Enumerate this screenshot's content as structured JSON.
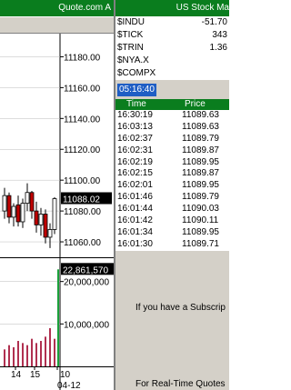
{
  "chart_window": {
    "title": "Quote.com  A"
  },
  "chart_data": {
    "type": "candlestick",
    "price_axis": {
      "ticks": [
        "11180.00",
        "11160.00",
        "11140.00",
        "11120.00",
        "11100.00",
        "11080.00",
        "11060.00"
      ],
      "tick_values": [
        11180,
        11160,
        11140,
        11120,
        11100,
        11080,
        11060
      ],
      "range": [
        11050,
        11195
      ]
    },
    "last_price": {
      "label": "11088.02",
      "value": 11088.02
    },
    "volume_axis": {
      "ticks": [
        "20,000,000",
        "10,000,000"
      ],
      "tick_values": [
        20000000,
        10000000
      ],
      "range": [
        0,
        25500000
      ]
    },
    "last_volume": {
      "label": "22,861,570",
      "value": 22861570
    },
    "x_ticks": [
      "14",
      "15",
      "10"
    ],
    "x_date_label": "04-12",
    "candles": [
      {
        "o": 11080,
        "h": 11095,
        "l": 11075,
        "c": 11090,
        "dir": "up"
      },
      {
        "o": 11090,
        "h": 11092,
        "l": 11072,
        "c": 11076,
        "dir": "down"
      },
      {
        "o": 11076,
        "h": 11085,
        "l": 11070,
        "c": 11083,
        "dir": "up"
      },
      {
        "o": 11084,
        "h": 11090,
        "l": 11070,
        "c": 11073,
        "dir": "down"
      },
      {
        "o": 11073,
        "h": 11088,
        "l": 11069,
        "c": 11085,
        "dir": "up"
      },
      {
        "o": 11085,
        "h": 11098,
        "l": 11080,
        "c": 11092,
        "dir": "up"
      },
      {
        "o": 11092,
        "h": 11093,
        "l": 11075,
        "c": 11080,
        "dir": "down"
      },
      {
        "o": 11080,
        "h": 11086,
        "l": 11066,
        "c": 11071,
        "dir": "down"
      },
      {
        "o": 11071,
        "h": 11082,
        "l": 11064,
        "c": 11078,
        "dir": "up"
      },
      {
        "o": 11078,
        "h": 11081,
        "l": 11059,
        "c": 11063,
        "dir": "down"
      },
      {
        "o": 11063,
        "h": 11072,
        "l": 11056,
        "c": 11068,
        "dir": "up"
      },
      {
        "o": 11068,
        "h": 11089,
        "l": 11065,
        "c": 11088,
        "dir": "up"
      }
    ],
    "volumes": [
      4000000,
      5000000,
      4500000,
      6000000,
      5500000,
      5000000,
      6500000,
      5500000,
      6000000,
      7000000,
      9000000,
      6500000,
      22861570
    ]
  },
  "market_window": {
    "title": "US Stock Ma",
    "indices": [
      {
        "symbol": "$INDU",
        "value": "-51.70"
      },
      {
        "symbol": "$TICK",
        "value": "343"
      },
      {
        "symbol": "$TRIN",
        "value": "1.36"
      },
      {
        "symbol": "$NYA.X",
        "value": ""
      },
      {
        "symbol": "$COMPX",
        "value": ""
      }
    ],
    "clock": "05:16:40",
    "time_sales": {
      "columns": [
        "Time",
        "Price"
      ],
      "rows": [
        {
          "time": "16:30:19",
          "price": "11089.63"
        },
        {
          "time": "16:03:13",
          "price": "11089.63"
        },
        {
          "time": "16:02:37",
          "price": "11089.79"
        },
        {
          "time": "16:02:31",
          "price": "11089.87"
        },
        {
          "time": "16:02:19",
          "price": "11089.95"
        },
        {
          "time": "16:02:15",
          "price": "11089.87"
        },
        {
          "time": "16:02:01",
          "price": "11089.95"
        },
        {
          "time": "16:01:46",
          "price": "11089.79"
        },
        {
          "time": "16:01:44",
          "price": "11090.03"
        },
        {
          "time": "16:01:42",
          "price": "11090.11"
        },
        {
          "time": "16:01:34",
          "price": "11089.95"
        },
        {
          "time": "16:01:30",
          "price": "11089.71"
        }
      ]
    },
    "ad_line_1": "If you have a Subscrip",
    "ad_line_2": "For Real-Time Quotes"
  }
}
